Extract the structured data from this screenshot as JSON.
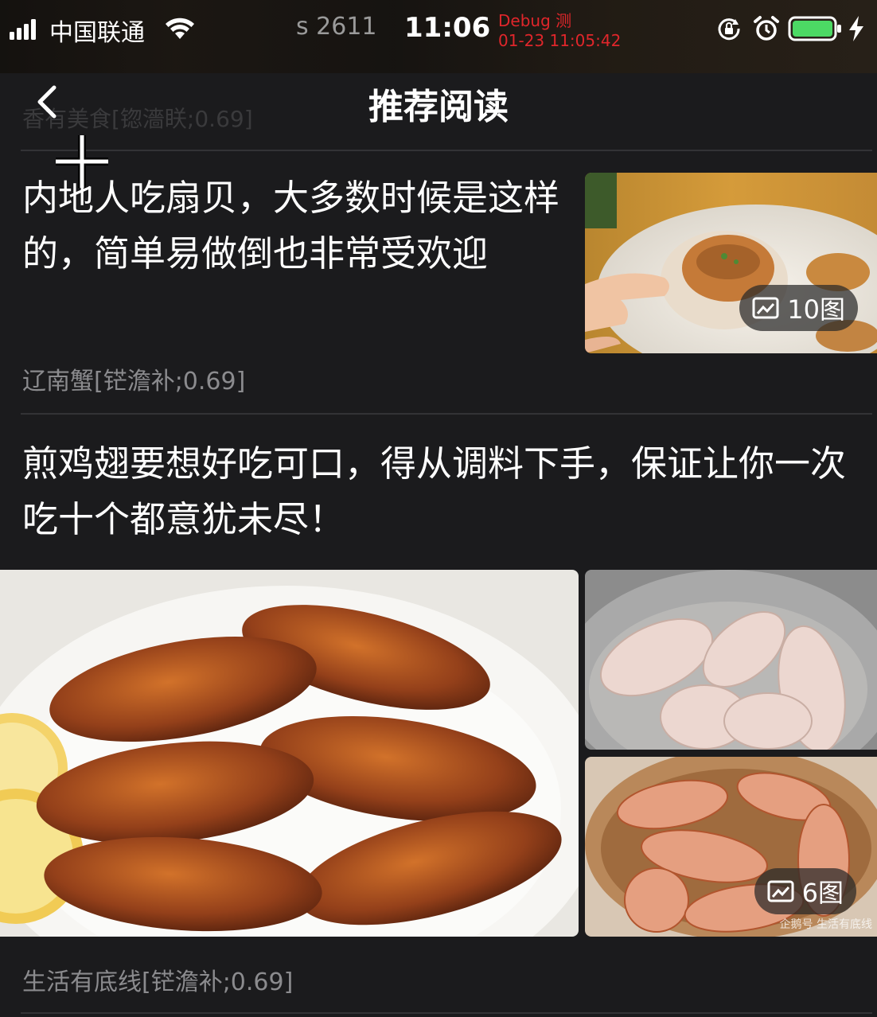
{
  "status_bar": {
    "carrier": "中国联通",
    "session_id": "s 2611",
    "time": "11:06",
    "debug_label": "Debug 测",
    "debug_timestamp": "01-23 11:05:42",
    "debug_color": "#e0262b",
    "battery_color": "#4cd964",
    "icons": [
      "signal-icon",
      "wifi-icon",
      "rotation-lock-icon",
      "alarm-icon",
      "battery-icon",
      "charging-icon"
    ]
  },
  "nav": {
    "title": "推荐阅读",
    "back_icon": "chevron-left-icon",
    "ghost_text": "香有美食[锪濇眹;0.69]"
  },
  "articles": [
    {
      "title": "内地人吃扇贝，大多数时候是这样的，简单易做倒也非常受欢迎",
      "source": "辽南蟹[铓澹补;0.69]",
      "image_count": "10图"
    },
    {
      "title": "煎鸡翅要想好吃可口，得从调料下手，保证让你一次吃十个都意犹未尽！",
      "source": "生活有底线[铓澹补;0.69]",
      "image_count": "6图",
      "watermark": "企鹅号 生活有底线"
    }
  ],
  "colors": {
    "background": "#1b1b1d",
    "source_text": "#8b8b8e",
    "divider": "#333336"
  }
}
